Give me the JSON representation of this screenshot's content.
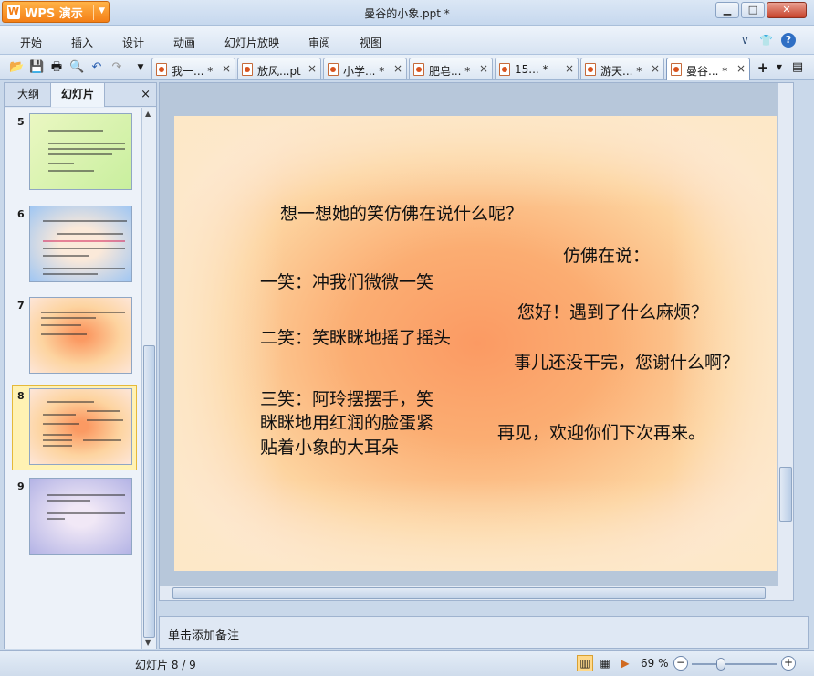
{
  "app": {
    "name": "WPS 演示",
    "window_title": "曼谷的小象.ppt *"
  },
  "menu": {
    "items": [
      "开始",
      "插入",
      "设计",
      "动画",
      "幻灯片放映",
      "审阅",
      "视图"
    ],
    "help_icon": "?"
  },
  "toolbar": {
    "tabs": [
      {
        "label": "我一... *",
        "active": false
      },
      {
        "label": "放风...pt",
        "active": false
      },
      {
        "label": "小学... *",
        "active": false
      },
      {
        "label": "肥皂... *",
        "active": false
      },
      {
        "label": "15... *",
        "active": false
      },
      {
        "label": "游天... *",
        "active": false
      },
      {
        "label": "曼谷... *",
        "active": true
      }
    ],
    "new_tab": "+",
    "close_glyph": "×"
  },
  "left_panel": {
    "tabs": [
      "大纲",
      "幻灯片"
    ],
    "active_tab": "幻灯片",
    "close_glyph": "×",
    "thumbnails": [
      {
        "number": "5"
      },
      {
        "number": "6"
      },
      {
        "number": "7"
      },
      {
        "number": "8",
        "selected": true
      },
      {
        "number": "9"
      }
    ]
  },
  "slide": {
    "lines": [
      "想一想她的笑仿佛在说什么呢？",
      "仿佛在说：",
      "一笑：冲我们微微一笑",
      "您好！遇到了什么麻烦？",
      "二笑：笑眯眯地摇了摇头",
      "事儿还没干完，您谢什么啊？",
      "三笑：阿玲摆摆手，笑",
      "眯眯地用红润的脸蛋紧",
      "贴着小象的大耳朵",
      "再见，欢迎你们下次再来。"
    ]
  },
  "notes": {
    "placeholder": "单击添加备注"
  },
  "status": {
    "slide_indicator": "幻灯片 8 / 9",
    "zoom": "69 %"
  },
  "colors": {
    "wps_orange": "#f47f16",
    "slide_center": "#fb9a63",
    "slide_edge": "#fcebcd",
    "selection": "#fff2b3"
  }
}
